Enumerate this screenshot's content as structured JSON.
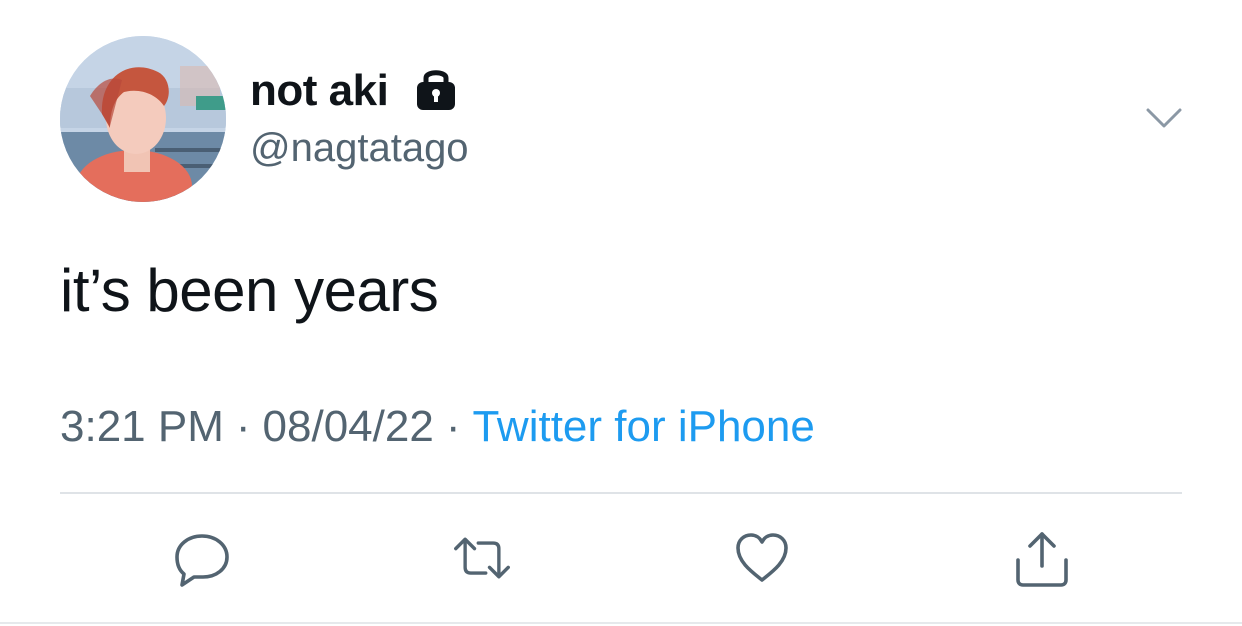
{
  "tweet": {
    "author": {
      "display_name": "not aki",
      "handle": "@nagtatago",
      "protected_icon": "lock-icon",
      "avatar": "profile-photo"
    },
    "menu_icon": "chevron-down-icon",
    "text": "it’s been years",
    "meta": {
      "time": "3:21 PM",
      "separator": "·",
      "date": "08/04/22",
      "source": "Twitter for iPhone"
    },
    "actions": [
      {
        "name": "reply",
        "icon": "reply-icon"
      },
      {
        "name": "retweet",
        "icon": "retweet-icon"
      },
      {
        "name": "like",
        "icon": "heart-icon"
      },
      {
        "name": "share",
        "icon": "share-icon"
      }
    ]
  },
  "colors": {
    "text_primary": "#0f1419",
    "text_secondary": "#536471",
    "link": "#1d9bf0",
    "divider": "#dfe3e7"
  }
}
